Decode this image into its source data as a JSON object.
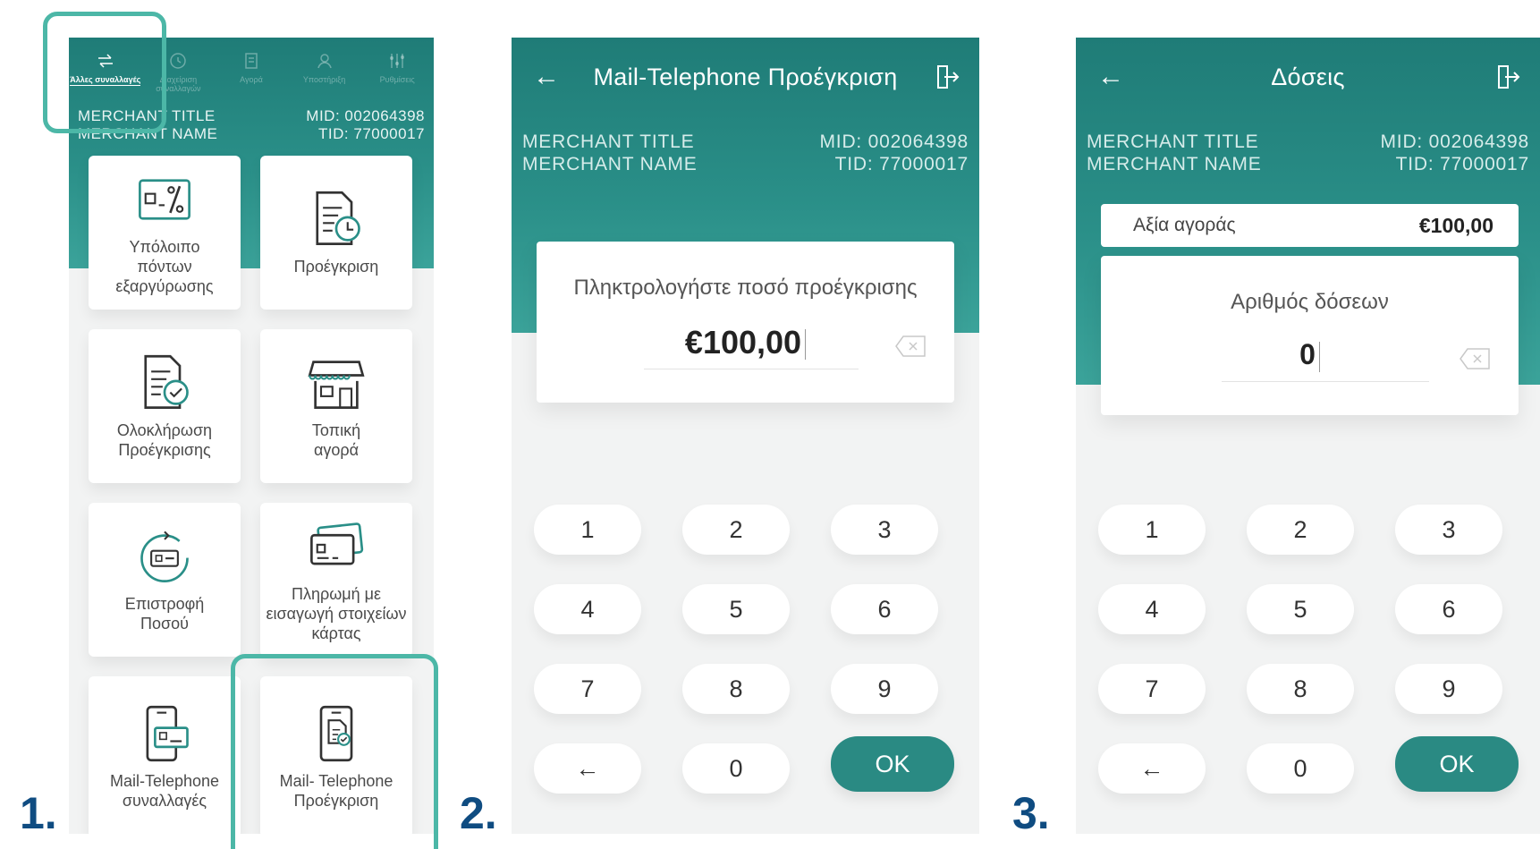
{
  "steps": [
    "1.",
    "2.",
    "3."
  ],
  "screen1": {
    "nav": [
      {
        "label": "Άλλες συναλλαγές",
        "icon": "arrows-icon",
        "active": true
      },
      {
        "label": "Διαχείριση συναλλαγών",
        "icon": "history-icon",
        "active": false
      },
      {
        "label": "Αγορά",
        "icon": "purchase-icon",
        "active": false
      },
      {
        "label": "Υποστήριξη",
        "icon": "support-icon",
        "active": false
      },
      {
        "label": "Ρυθμίσεις",
        "icon": "settings-icon",
        "active": false
      }
    ],
    "merchant_title": "MERCHANT TITLE",
    "merchant_name": "MERCHANT NAME",
    "mid": "MID: 002064398",
    "tid": "TID: 77000017",
    "tiles": [
      {
        "label": "Υπόλοιπο πόντων εξαργύρωσης",
        "icon": "points-percent-icon"
      },
      {
        "label": "Προέγκριση",
        "icon": "document-clock-icon"
      },
      {
        "label": "Ολοκλήρωση Προέγκρισης",
        "icon": "document-check-icon"
      },
      {
        "label": "Τοπική αγορά",
        "icon": "store-icon"
      },
      {
        "label": "Επιστροφή Ποσού",
        "icon": "refund-card-icon"
      },
      {
        "label": "Πληρωμή με εισαγωγή στοιχείων κάρτας",
        "icon": "cards-icon"
      },
      {
        "label": "Mail-Telephone συναλλαγές",
        "icon": "phone-card-icon"
      },
      {
        "label": "Mail- Telephone Προέγκριση",
        "icon": "phone-document-icon"
      }
    ]
  },
  "screen2": {
    "title": "Mail-Telephone Προέγκριση",
    "merchant_title": "MERCHANT TITLE",
    "merchant_name": "MERCHANT NAME",
    "mid": "MID: 002064398",
    "tid": "TID: 77000017",
    "prompt": "Πληκτρολογήστε ποσό προέγκρισης",
    "amount": "€100,00"
  },
  "screen3": {
    "title": "Δόσεις",
    "merchant_title": "MERCHANT TITLE",
    "merchant_name": "MERCHANT NAME",
    "mid": "MID: 002064398",
    "tid": "TID: 77000017",
    "purchase_label": "Αξία αγοράς",
    "purchase_value": "€100,00",
    "prompt": "Αριθμός δόσεων",
    "amount": "0"
  },
  "keypad": {
    "keys": [
      "1",
      "2",
      "3",
      "4",
      "5",
      "6",
      "7",
      "8",
      "9",
      "←",
      "0",
      "OK"
    ]
  },
  "colors": {
    "teal": "#2a8f88",
    "highlight": "#4cb7a7",
    "step_number": "#0f4c81",
    "ok_button": "#2a8a83"
  }
}
